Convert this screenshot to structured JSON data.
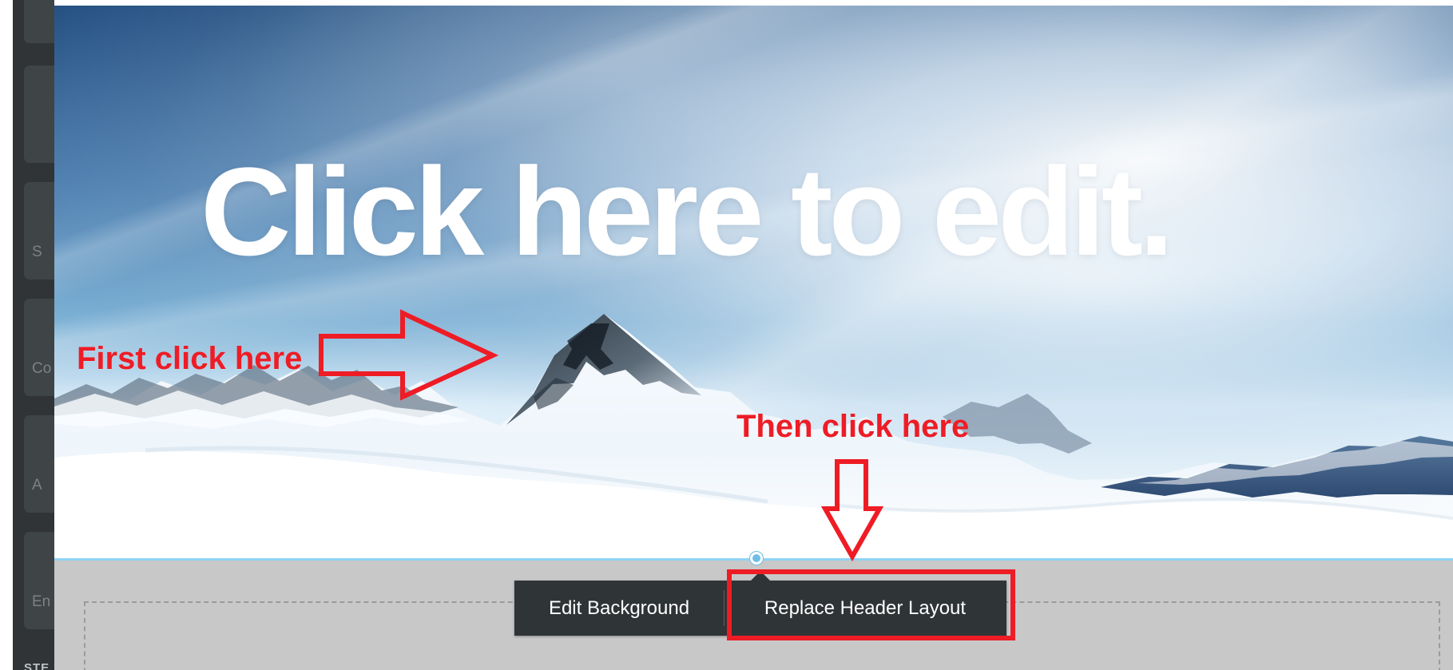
{
  "sidebar": {
    "items": [
      {
        "label": ""
      },
      {
        "label": ""
      },
      {
        "label": "S"
      },
      {
        "label": "Co"
      },
      {
        "label": "A"
      },
      {
        "label": "En"
      }
    ],
    "footer_label": "STE"
  },
  "hero": {
    "headline": "Click here to edit."
  },
  "annotations": {
    "first_step": "First click here",
    "second_step": "Then click here",
    "accent_color": "#ee1c25"
  },
  "toolbar": {
    "edit_background_label": "Edit Background",
    "replace_header_layout_label": "Replace Header Layout",
    "background_color": "#2f3436"
  },
  "icons": {
    "right_arrow": "right-arrow-icon",
    "down_arrow": "down-arrow-icon",
    "handle": "circle-handle-icon"
  }
}
